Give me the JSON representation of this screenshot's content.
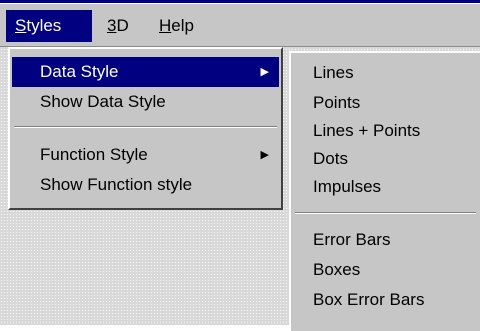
{
  "menubar": {
    "items": [
      {
        "accel": "S",
        "rest": "tyles"
      },
      {
        "accel": "3",
        "rest": "D"
      },
      {
        "accel": "H",
        "rest": "elp"
      }
    ]
  },
  "styles_menu": {
    "items": [
      {
        "label": "Data Style",
        "arrow": "▶"
      },
      {
        "label": "Show Data Style"
      },
      {
        "label": "Function Style",
        "arrow": "▶"
      },
      {
        "label": "Show Function style"
      }
    ]
  },
  "data_style_submenu": {
    "items": [
      {
        "label": "Lines"
      },
      {
        "label": "Points"
      },
      {
        "label": "Lines + Points"
      },
      {
        "label": "Dots"
      },
      {
        "label": "Impulses"
      },
      {
        "label": "Error Bars"
      },
      {
        "label": "Boxes"
      },
      {
        "label": "Box Error Bars"
      }
    ]
  },
  "colors": {
    "highlight": "#000080",
    "menu_face": "#c6c6c6"
  }
}
